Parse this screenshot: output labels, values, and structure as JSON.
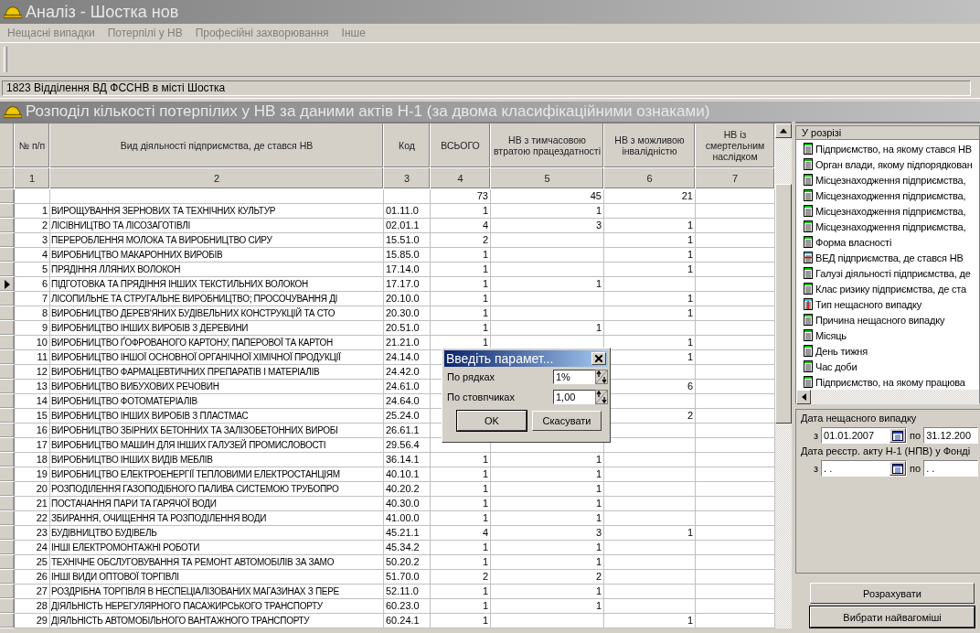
{
  "window": {
    "title": "Аналіз - Шостка нов"
  },
  "menu": [
    {
      "label": "Нещасні випадки"
    },
    {
      "label": "Потерпілі у НВ"
    },
    {
      "label": "Професійні захворювання"
    },
    {
      "label": "Інше"
    }
  ],
  "organization": "1823 Відділення ВД ФССНВ в місті Шостка",
  "report": {
    "title": "Розподіл кількості потерпілих у НВ за даними актів Н-1 (за двома класифікаційними ознаками)",
    "columns": [
      {
        "label": "№ п/п",
        "number": "1"
      },
      {
        "label": "Вид діяльності підприємства, де стався НВ",
        "number": "2"
      },
      {
        "label": "Код",
        "number": "3"
      },
      {
        "label": "ВСЬОГО",
        "number": "4"
      },
      {
        "label": "НВ з тимчасовою втратою працездатності",
        "number": "5"
      },
      {
        "label": "НВ з можливою інвалідністю",
        "number": "6"
      },
      {
        "label": "НВ із смертельним наслідком",
        "number": "7"
      }
    ],
    "rows": [
      {
        "selected": false,
        "total": "73",
        "temporary": "45",
        "disability": "21"
      },
      {
        "selected": false,
        "n": "1",
        "activity": "ВИРОЩУВАННЯ ЗЕРНОВИХ ТА ТЕХНІЧНИХ КУЛЬТУР",
        "code": "01.11.0",
        "total": "1",
        "temporary": "1"
      },
      {
        "selected": false,
        "n": "2",
        "activity": "ЛІСІВНИЦТВО ТА ЛІСОЗАГОТІВЛІ",
        "code": "02.01.1",
        "total": "4",
        "temporary": "3",
        "disability": "1"
      },
      {
        "selected": false,
        "n": "3",
        "activity": "ПЕРЕРОБЛЕННЯ МОЛОКА ТА ВИРОБНИЦТВО СИРУ",
        "code": "15.51.0",
        "total": "2",
        "disability": "1"
      },
      {
        "selected": false,
        "n": "4",
        "activity": "ВИРОБНИЦТВО МАКАРОННИХ ВИРОБІВ",
        "code": "15.85.0",
        "total": "1",
        "disability": "1"
      },
      {
        "selected": false,
        "n": "5",
        "activity": "ПРЯДІННЯ ЛЛЯНИХ ВОЛОКОН",
        "code": "17.14.0",
        "total": "1",
        "disability": "1"
      },
      {
        "selected": true,
        "n": "6",
        "activity": "ПІДГОТОВКА ТА ПРЯДІННЯ ІНШИХ ТЕКСТИЛЬНИХ ВОЛОКОН",
        "code": "17.17.0",
        "total": "1",
        "temporary": "1"
      },
      {
        "selected": false,
        "n": "7",
        "activity": "ЛІСОПИЛЬНЕ ТА СТРУГАЛЬНЕ ВИРОБНИЦТВО; ПРОСОЧУВАННЯ ДІ",
        "code": "20.10.0",
        "total": "1",
        "disability": "1"
      },
      {
        "selected": false,
        "n": "8",
        "activity": "ВИРОБНИЦТВО ДЕРЕВ'ЯНИХ БУДІВЕЛЬНИХ КОНСТРУКЦІЙ ТА СТО",
        "code": "20.30.0",
        "total": "1",
        "disability": "1"
      },
      {
        "selected": false,
        "n": "9",
        "activity": "ВИРОБНИЦТВО ІНШИХ ВИРОБІВ З ДЕРЕВИНИ",
        "code": "20.51.0",
        "total": "1",
        "temporary": "1"
      },
      {
        "selected": false,
        "n": "10",
        "activity": "ВИРОБНИЦТВО ҐОФРОВАНОГО КАРТОНУ, ПАПЕРОВОЇ ТА КАРТОН",
        "code": "21.21.0",
        "total": "1",
        "disability": "1"
      },
      {
        "selected": false,
        "n": "11",
        "activity": "ВИРОБНИЦТВО ІНШОЇ ОСНОВНОЇ ОРГАНІЧНОЇ ХІМІЧНОЇ ПРОДУКЦІЇ",
        "code": "24.14.0",
        "disability": "1"
      },
      {
        "selected": false,
        "n": "12",
        "activity": "ВИРОБНИЦТВО ФАРМАЦЕВТИЧНИХ ПРЕПАРАТІВ І МАТЕРІАЛІВ",
        "code": "24.42.0"
      },
      {
        "selected": false,
        "n": "13",
        "activity": "ВИРОБНИЦТВО ВИБУХОВИХ РЕЧОВИН",
        "code": "24.61.0",
        "disability": "6"
      },
      {
        "selected": false,
        "n": "14",
        "activity": "ВИРОБНИЦТВО ФОТОМАТЕРІАЛІВ",
        "code": "24.64.0"
      },
      {
        "selected": false,
        "n": "15",
        "activity": "ВИРОБНИЦТВО ІНШИХ ВИРОБІВ З ПЛАСТМАС",
        "code": "25.24.0",
        "disability": "2"
      },
      {
        "selected": false,
        "n": "16",
        "activity": "ВИРОБНИЦТВО ЗБІРНИХ БЕТОННИХ ТА ЗАЛІЗОБЕТОННИХ ВИРОБІ",
        "code": "26.61.1"
      },
      {
        "selected": false,
        "n": "17",
        "activity": "ВИРОБНИЦТВО МАШИН ДЛЯ ІНШИХ ГАЛУЗЕЙ ПРОМИСЛОВОСТІ",
        "code": "29.56.4"
      },
      {
        "selected": false,
        "n": "18",
        "activity": "ВИРОБНИЦТВО ІНШИХ ВИДІВ МЕБЛІВ",
        "code": "36.14.1",
        "total": "1",
        "temporary": "1"
      },
      {
        "selected": false,
        "n": "19",
        "activity": "ВИРОБНИЦТВО ЕЛЕКТРОЕНЕРГІЇ ТЕПЛОВИМИ ЕЛЕКТРОСТАНЦІЯМ",
        "code": "40.10.1",
        "total": "1",
        "temporary": "1"
      },
      {
        "selected": false,
        "n": "20",
        "activity": "РОЗПОДІЛЕННЯ ГАЗОПОДІБНОГО ПАЛИВА СИСТЕМОЮ ТРУБОПРО",
        "code": "40.20.2",
        "total": "1",
        "temporary": "1"
      },
      {
        "selected": false,
        "n": "21",
        "activity": "ПОСТАЧАННЯ ПАРИ ТА ГАРЯЧОЇ ВОДИ",
        "code": "40.30.0",
        "total": "1",
        "temporary": "1"
      },
      {
        "selected": false,
        "n": "22",
        "activity": "ЗБИРАННЯ, ОЧИЩЕННЯ ТА РОЗПОДІЛЕННЯ ВОДИ",
        "code": "41.00.0",
        "total": "1",
        "temporary": "1"
      },
      {
        "selected": false,
        "n": "23",
        "activity": "БУДІВНИЦТВО БУДІВЕЛЬ",
        "code": "45.21.1",
        "total": "4",
        "temporary": "3",
        "disability": "1"
      },
      {
        "selected": false,
        "n": "24",
        "activity": "ІНШІ ЕЛЕКТРОМОНТАЖНІ РОБОТИ",
        "code": "45.34.2",
        "total": "1",
        "temporary": "1"
      },
      {
        "selected": false,
        "n": "25",
        "activity": "ТЕХНІЧНЕ ОБСЛУГОВУВАННЯ ТА РЕМОНТ АВТОМОБІЛІВ ЗА ЗАМО",
        "code": "50.20.2",
        "total": "1",
        "temporary": "1"
      },
      {
        "selected": false,
        "n": "26",
        "activity": "ІНШІ ВИДИ ОПТОВОЇ ТОРГІВЛІ",
        "code": "51.70.0",
        "total": "2",
        "temporary": "2"
      },
      {
        "selected": false,
        "n": "27",
        "activity": "РОЗДРІБНА ТОРГІВЛЯ В НЕСПЕЦІАЛІЗОВАНИХ МАГАЗИНАХ З ПЕРЕ",
        "code": "52.11.0",
        "total": "1",
        "temporary": "1"
      },
      {
        "selected": false,
        "n": "28",
        "activity": "ДІЯЛЬНІСТЬ НЕРЕГУЛЯРНОГО ПАСАЖИРСЬКОГО ТРАНСПОРТУ",
        "code": "60.23.0",
        "total": "1",
        "temporary": "1"
      },
      {
        "selected": false,
        "n": "29",
        "activity": "ДІЯЛЬНІСТЬ АВТОМОБІЛЬНОГО ВАНТАЖНОГО ТРАНСПОРТУ",
        "code": "60.24.1",
        "total": "1",
        "disability": "1"
      }
    ]
  },
  "breakdown": {
    "header": "У розрізі",
    "items": [
      {
        "label": "Підприємство, на якому стався НВ",
        "kind": "standard"
      },
      {
        "label": "Орган влади, якому підпорядкован",
        "kind": "standard"
      },
      {
        "label": "Місцезнаходження підприємства,",
        "kind": "standard"
      },
      {
        "label": "Місцезнаходження підприємства,",
        "kind": "standard"
      },
      {
        "label": "Місцезнаходження підприємства,",
        "kind": "standard"
      },
      {
        "label": "Місцезнаходження підприємства,",
        "kind": "standard"
      },
      {
        "label": "Форма власності",
        "kind": "standard"
      },
      {
        "label": "ВЕД підприємства, де стався НВ",
        "kind": "crossed"
      },
      {
        "label": "Галузі діяльності підприємства, де",
        "kind": "standard"
      },
      {
        "label": "Клас ризику підприємства, де ста",
        "kind": "standard"
      },
      {
        "label": "Тип нещасного випадку",
        "kind": "marked"
      },
      {
        "label": "Причина нещасного випадку",
        "kind": "standard"
      },
      {
        "label": "Місяць",
        "kind": "standard"
      },
      {
        "label": "День тижня",
        "kind": "standard"
      },
      {
        "label": "Час доби",
        "kind": "standard"
      },
      {
        "label": "Підприємство, на якому працюва",
        "kind": "standard"
      }
    ]
  },
  "dates": [
    {
      "label": "Дата нещасного випадку",
      "from_label": "з",
      "from": "01.01.2007",
      "to_label": "по",
      "to": "31.12.200"
    },
    {
      "label": "Дата реєстр. акту Н-1 (НПВ) у Фонді",
      "from_label": "з",
      "from": ". .",
      "to_label": "по",
      "to": ". ."
    }
  ],
  "actions": [
    {
      "label": "Розрахувати",
      "default": false
    },
    {
      "label": "Вибрати найвагоміші",
      "default": true
    }
  ],
  "dialog": {
    "title": "Введіть парамет...",
    "fields": [
      {
        "label": "По рядках",
        "value": "1%"
      },
      {
        "label": "По стовпчиках",
        "value": "1,00"
      }
    ],
    "buttons": [
      {
        "label": "OK",
        "default": true
      },
      {
        "label": "Скасувати",
        "default": false
      }
    ]
  }
}
